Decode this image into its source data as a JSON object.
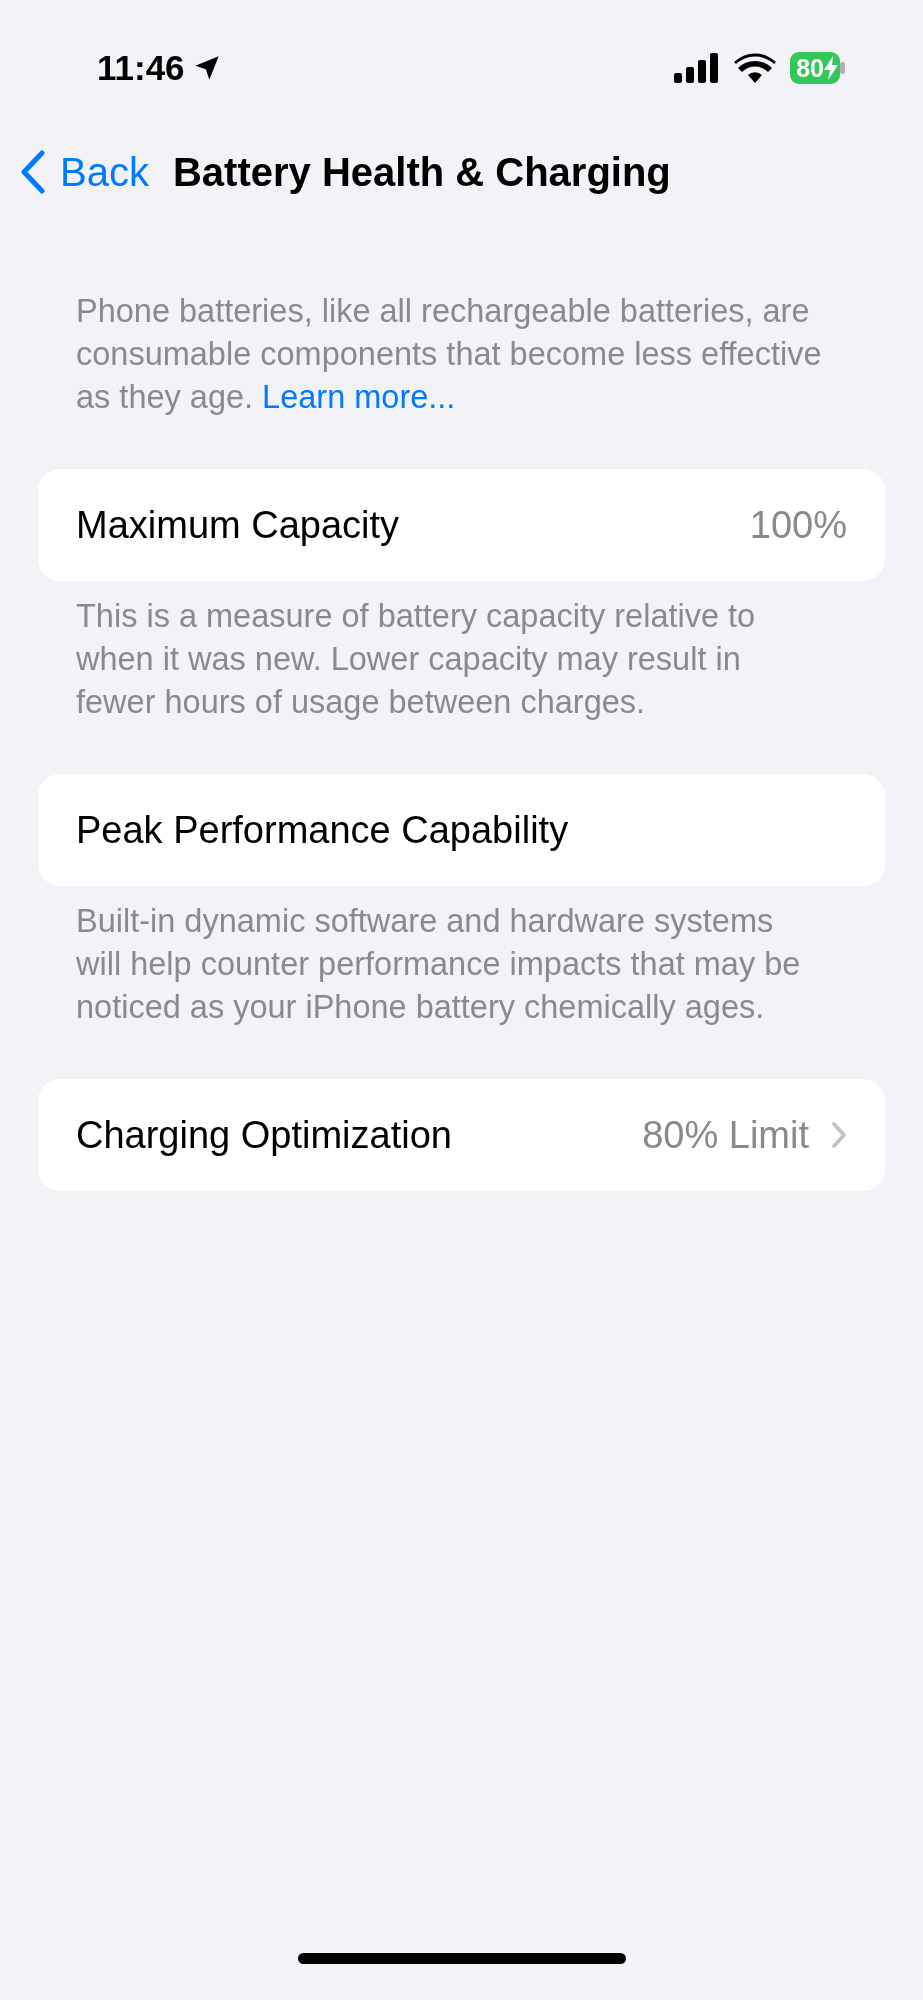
{
  "status_bar": {
    "time": "11:46",
    "battery": "80",
    "charging": true
  },
  "nav": {
    "back": "Back",
    "title": "Battery Health & Charging"
  },
  "sections": [
    {
      "kind": "text",
      "text": "Phone batteries, like all rechargeable batteries, are consumable components that become less effective as they age.",
      "link": "Learn more..."
    },
    {
      "kind": "row",
      "label": "Maximum Capacity",
      "value": "100%",
      "chevron": false
    },
    {
      "kind": "text",
      "text": "This is a measure of battery capacity relative to when it was new. Lower capacity may result in fewer hours of usage between charges."
    },
    {
      "kind": "row",
      "label": "Peak Performance Capability",
      "chevron": false
    },
    {
      "kind": "text",
      "text": "Built-in dynamic software and hardware systems will help counter performance impacts that may be noticed as your iPhone battery chemically ages."
    },
    {
      "kind": "row",
      "label": "Charging Optimization",
      "value": "80% Limit",
      "chevron": true
    }
  ]
}
